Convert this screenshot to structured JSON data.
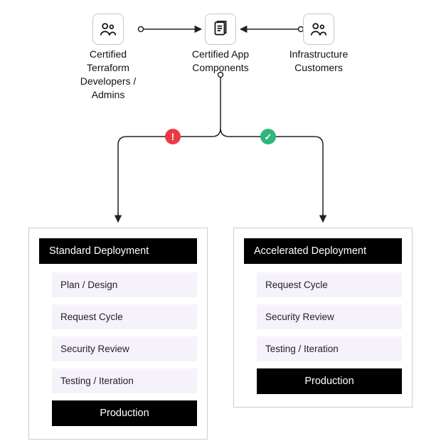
{
  "top": {
    "left_label": "Certified\nTerraform\nDevelopers /\nAdmins",
    "center_label": "Certified App\nComponents",
    "right_label": "Infrastructure\nCustomers"
  },
  "badges": {
    "left": "!",
    "right": "✓"
  },
  "panels": {
    "standard": {
      "title": "Standard Deployment",
      "steps": [
        "Plan / Design",
        "Request Cycle",
        "Security Review",
        "Testing / Iteration"
      ],
      "production": "Production"
    },
    "accelerated": {
      "title": "Accelerated Deployment",
      "steps": [
        "Request Cycle",
        "Security Review",
        "Testing / Iteration"
      ],
      "production": "Production"
    }
  },
  "colors": {
    "alert": "#ec3944",
    "success": "#2eb67d",
    "step_bg": "#f6f2fb",
    "header_bg": "#000000"
  }
}
